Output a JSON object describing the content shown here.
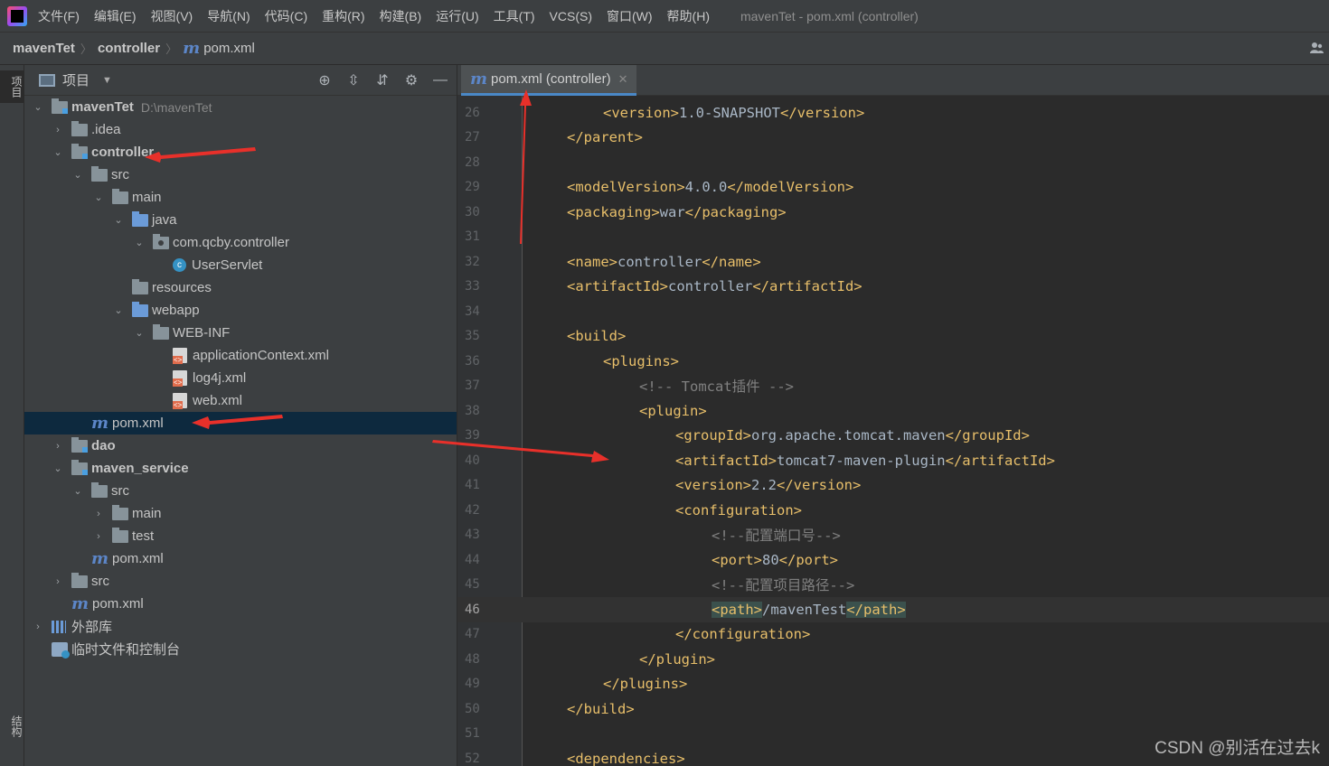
{
  "menu": {
    "items": [
      "文件(F)",
      "编辑(E)",
      "视图(V)",
      "导航(N)",
      "代码(C)",
      "重构(R)",
      "构建(B)",
      "运行(U)",
      "工具(T)",
      "VCS(S)",
      "窗口(W)",
      "帮助(H)"
    ],
    "window_title": "mavenTet - pom.xml (controller)"
  },
  "breadcrumb": {
    "project": "mavenTet",
    "module": "controller",
    "file": "pom.xml",
    "file_icon": "m"
  },
  "left_strip": {
    "project_tab": "项目",
    "structure_tab": "结构"
  },
  "project_panel": {
    "title": "项目",
    "tree": [
      {
        "label": "mavenTet",
        "hint": "D:\\mavenTet",
        "bold": true
      },
      {
        "label": ".idea"
      },
      {
        "label": "controller",
        "bold": true
      },
      {
        "label": "src"
      },
      {
        "label": "main"
      },
      {
        "label": "java"
      },
      {
        "label": "com.qcby.controller"
      },
      {
        "label": "UserServlet"
      },
      {
        "label": "resources"
      },
      {
        "label": "webapp"
      },
      {
        "label": "WEB-INF"
      },
      {
        "label": "applicationContext.xml"
      },
      {
        "label": "log4j.xml"
      },
      {
        "label": "web.xml"
      },
      {
        "label": "pom.xml",
        "selected": true
      },
      {
        "label": "dao",
        "bold": true
      },
      {
        "label": "maven_service",
        "bold": true
      },
      {
        "label": "src"
      },
      {
        "label": "main"
      },
      {
        "label": "test"
      },
      {
        "label": "pom.xml"
      },
      {
        "label": "src"
      },
      {
        "label": "pom.xml"
      },
      {
        "label": "外部库"
      },
      {
        "label": "临时文件和控制台"
      }
    ]
  },
  "editor": {
    "tab_label": "pom.xml (controller)",
    "current_line": 46,
    "lines": [
      {
        "n": "26",
        "indent": 2,
        "parts": [
          [
            "tag",
            "<version>"
          ],
          [
            "txt",
            "1.0-SNAPSHOT"
          ],
          [
            "tag",
            "</version>"
          ]
        ]
      },
      {
        "n": "27",
        "indent": 1,
        "parts": [
          [
            "tag",
            "</parent>"
          ]
        ]
      },
      {
        "n": "28",
        "indent": 0,
        "parts": []
      },
      {
        "n": "29",
        "indent": 1,
        "parts": [
          [
            "tag",
            "<modelVersion>"
          ],
          [
            "txt",
            "4.0.0"
          ],
          [
            "tag",
            "</modelVersion>"
          ]
        ]
      },
      {
        "n": "30",
        "indent": 1,
        "parts": [
          [
            "tag",
            "<packaging>"
          ],
          [
            "txt",
            "war"
          ],
          [
            "tag",
            "</packaging>"
          ]
        ]
      },
      {
        "n": "31",
        "indent": 0,
        "parts": []
      },
      {
        "n": "32",
        "indent": 1,
        "parts": [
          [
            "tag",
            "<name>"
          ],
          [
            "txt",
            "controller"
          ],
          [
            "tag",
            "</name>"
          ]
        ]
      },
      {
        "n": "33",
        "indent": 1,
        "parts": [
          [
            "tag",
            "<artifactId>"
          ],
          [
            "txt",
            "controller"
          ],
          [
            "tag",
            "</artifactId>"
          ]
        ]
      },
      {
        "n": "34",
        "indent": 0,
        "parts": []
      },
      {
        "n": "35",
        "indent": 1,
        "parts": [
          [
            "tag",
            "<build>"
          ]
        ]
      },
      {
        "n": "36",
        "indent": 2,
        "parts": [
          [
            "tag",
            "<plugins>"
          ]
        ]
      },
      {
        "n": "37",
        "indent": 3,
        "parts": [
          [
            "cmt",
            "<!-- Tomcat插件 -->"
          ]
        ]
      },
      {
        "n": "38",
        "indent": 3,
        "parts": [
          [
            "tag",
            "<plugin>"
          ]
        ]
      },
      {
        "n": "39",
        "indent": 4,
        "parts": [
          [
            "tag",
            "<groupId>"
          ],
          [
            "txt",
            "org.apache.tomcat.maven"
          ],
          [
            "tag",
            "</groupId>"
          ]
        ]
      },
      {
        "n": "40",
        "indent": 4,
        "parts": [
          [
            "tag",
            "<artifactId>"
          ],
          [
            "txt",
            "tomcat7-maven-plugin"
          ],
          [
            "tag",
            "</artifactId>"
          ]
        ]
      },
      {
        "n": "41",
        "indent": 4,
        "parts": [
          [
            "tag",
            "<version>"
          ],
          [
            "txt",
            "2.2"
          ],
          [
            "tag",
            "</version>"
          ]
        ]
      },
      {
        "n": "42",
        "indent": 4,
        "parts": [
          [
            "tag",
            "<configuration>"
          ]
        ]
      },
      {
        "n": "43",
        "indent": 5,
        "parts": [
          [
            "cmt",
            "<!--配置端口号-->"
          ]
        ]
      },
      {
        "n": "44",
        "indent": 5,
        "parts": [
          [
            "tag",
            "<port>"
          ],
          [
            "txt",
            "80"
          ],
          [
            "tag",
            "</port>"
          ]
        ]
      },
      {
        "n": "45",
        "indent": 5,
        "parts": [
          [
            "cmt",
            "<!--配置项目路径-->"
          ]
        ]
      },
      {
        "n": "46",
        "indent": 5,
        "parts": [
          [
            "hltag",
            "<path>"
          ],
          [
            "txt",
            "/mavenTest"
          ],
          [
            "hltag",
            "</path>"
          ]
        ]
      },
      {
        "n": "47",
        "indent": 4,
        "parts": [
          [
            "tag",
            "</configuration>"
          ]
        ]
      },
      {
        "n": "48",
        "indent": 3,
        "parts": [
          [
            "tag",
            "</plugin>"
          ]
        ]
      },
      {
        "n": "49",
        "indent": 2,
        "parts": [
          [
            "tag",
            "</plugins>"
          ]
        ]
      },
      {
        "n": "50",
        "indent": 1,
        "parts": [
          [
            "tag",
            "</build>"
          ]
        ]
      },
      {
        "n": "51",
        "indent": 0,
        "parts": []
      },
      {
        "n": "52",
        "indent": 1,
        "parts": [
          [
            "tag",
            "<dependencies>"
          ]
        ]
      }
    ]
  },
  "watermark": "CSDN @别活在过去k",
  "colors": {
    "tag": "#e8bf6a",
    "text": "#a9b7c6",
    "comment": "#808080",
    "selection": "#0d293e",
    "arrow": "#e8302a"
  }
}
